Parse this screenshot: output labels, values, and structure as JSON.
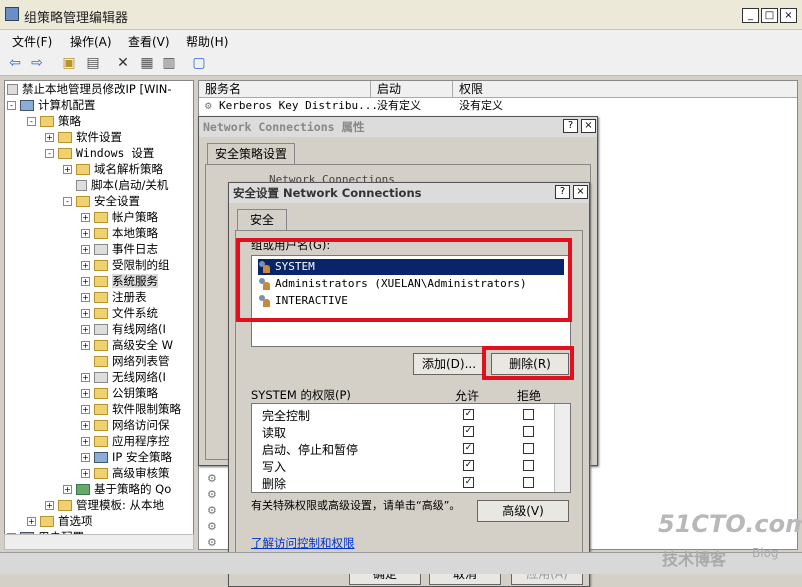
{
  "window": {
    "title": "组策略管理编辑器"
  },
  "menu": {
    "file": "文件(F)",
    "action": "操作(A)",
    "view": "查看(V)",
    "help": "帮助(H)"
  },
  "tree": {
    "root": "禁止本地管理员修改IP [WIN-",
    "items": [
      "计算机配置",
      "策略",
      "软件设置",
      "Windows 设置",
      "域名解析策略",
      "脚本(启动/关机",
      "安全设置",
      "帐户策略",
      "本地策略",
      "事件日志",
      "受限制的组",
      "系统服务",
      "注册表",
      "文件系统",
      "有线网络(I",
      "高级安全 W",
      "网络列表管",
      "无线网络(I",
      "公钥策略",
      "软件限制策略",
      "网络访问保",
      "应用程序控",
      "IP 安全策略",
      "高级审核策",
      "基于策略的 Qo",
      "管理模板: 从本地",
      "首选项",
      "用户配置"
    ]
  },
  "list": {
    "col_name": "服务名",
    "col_start": "启动",
    "col_perm": "权限",
    "row_name": "Kerberos Key Distribu...",
    "row_start": "没有定义",
    "row_perm": "没有定义"
  },
  "props_dialog": {
    "title": "Network Connections 属性",
    "tab": "安全策略设置",
    "partial": "Network Connections"
  },
  "sec_dialog": {
    "title": "安全设置 Network Connections",
    "tab": "安全",
    "group_label": "组或用户名(G):",
    "users": [
      "SYSTEM",
      "Administrators (XUELAN\\Administrators)",
      "INTERACTIVE"
    ],
    "add": "添加(D)...",
    "remove": "删除(R)",
    "perm_label": "SYSTEM 的权限(P)",
    "allow": "允许",
    "deny": "拒绝",
    "permissions": [
      "完全控制",
      "读取",
      "启动、停止和暂停",
      "写入",
      "删除"
    ],
    "special_note": "有关特殊权限或高级设置，请单击“高级”。",
    "advanced": "高级(V)",
    "link": "了解访问控制和权限",
    "ok": "确定",
    "cancel": "取消",
    "apply": "应用(A)"
  },
  "watermark": {
    "brand": "51CTO.com",
    "sub": "技术博客",
    "blog": "Blog"
  },
  "colors": {
    "highlight": "#0a246a",
    "red_annotation": "#e0101e"
  }
}
